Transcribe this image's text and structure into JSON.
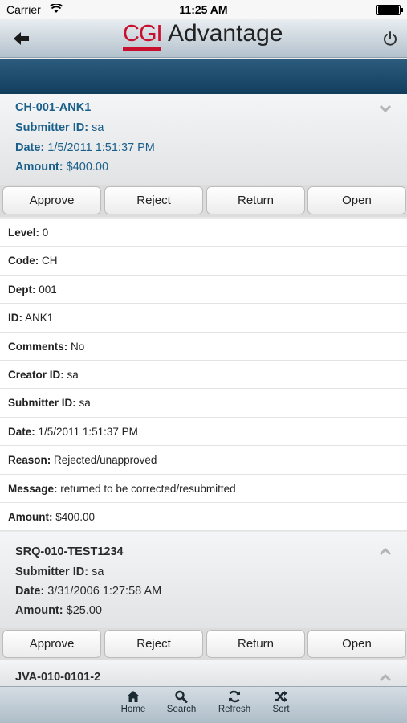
{
  "status_bar": {
    "carrier": "Carrier",
    "time": "11:25 AM"
  },
  "header": {
    "logo_cgi": "CGI",
    "logo_advantage": "Advantage"
  },
  "items": [
    {
      "title": "CH-001-ANK1",
      "submitter_label": "Submitter ID:",
      "submitter_value": "sa",
      "date_label": "Date:",
      "date_value": "1/5/2011 1:51:37 PM",
      "amount_label": "Amount:",
      "amount_value": "$400.00"
    },
    {
      "title": "SRQ-010-TEST1234",
      "submitter_label": "Submitter ID:",
      "submitter_value": "sa",
      "date_label": "Date:",
      "date_value": "3/31/2006 1:27:58 AM",
      "amount_label": "Amount:",
      "amount_value": "$25.00"
    },
    {
      "title": "JVA-010-0101-2"
    }
  ],
  "actions": {
    "approve": "Approve",
    "reject": "Reject",
    "return": "Return",
    "open": "Open"
  },
  "details": [
    {
      "label": "Level:",
      "value": "0"
    },
    {
      "label": "Code:",
      "value": "CH"
    },
    {
      "label": "Dept:",
      "value": "001"
    },
    {
      "label": "ID:",
      "value": "ANK1"
    },
    {
      "label": "Comments:",
      "value": "No"
    },
    {
      "label": "Creator ID:",
      "value": "sa"
    },
    {
      "label": "Submitter ID:",
      "value": "sa"
    },
    {
      "label": "Date:",
      "value": "1/5/2011 1:51:37 PM"
    },
    {
      "label": "Reason:",
      "value": "Rejected/unapproved"
    },
    {
      "label": "Message:",
      "value": "returned to be corrected/resubmitted"
    },
    {
      "label": "Amount:",
      "value": "$400.00"
    }
  ],
  "tabs": {
    "home": "Home",
    "search": "Search",
    "refresh": "Refresh",
    "sort": "Sort"
  },
  "colors": {
    "accent_blue": "#1a5f8a",
    "band": "#123e5e",
    "logo_red": "#c8102e"
  }
}
